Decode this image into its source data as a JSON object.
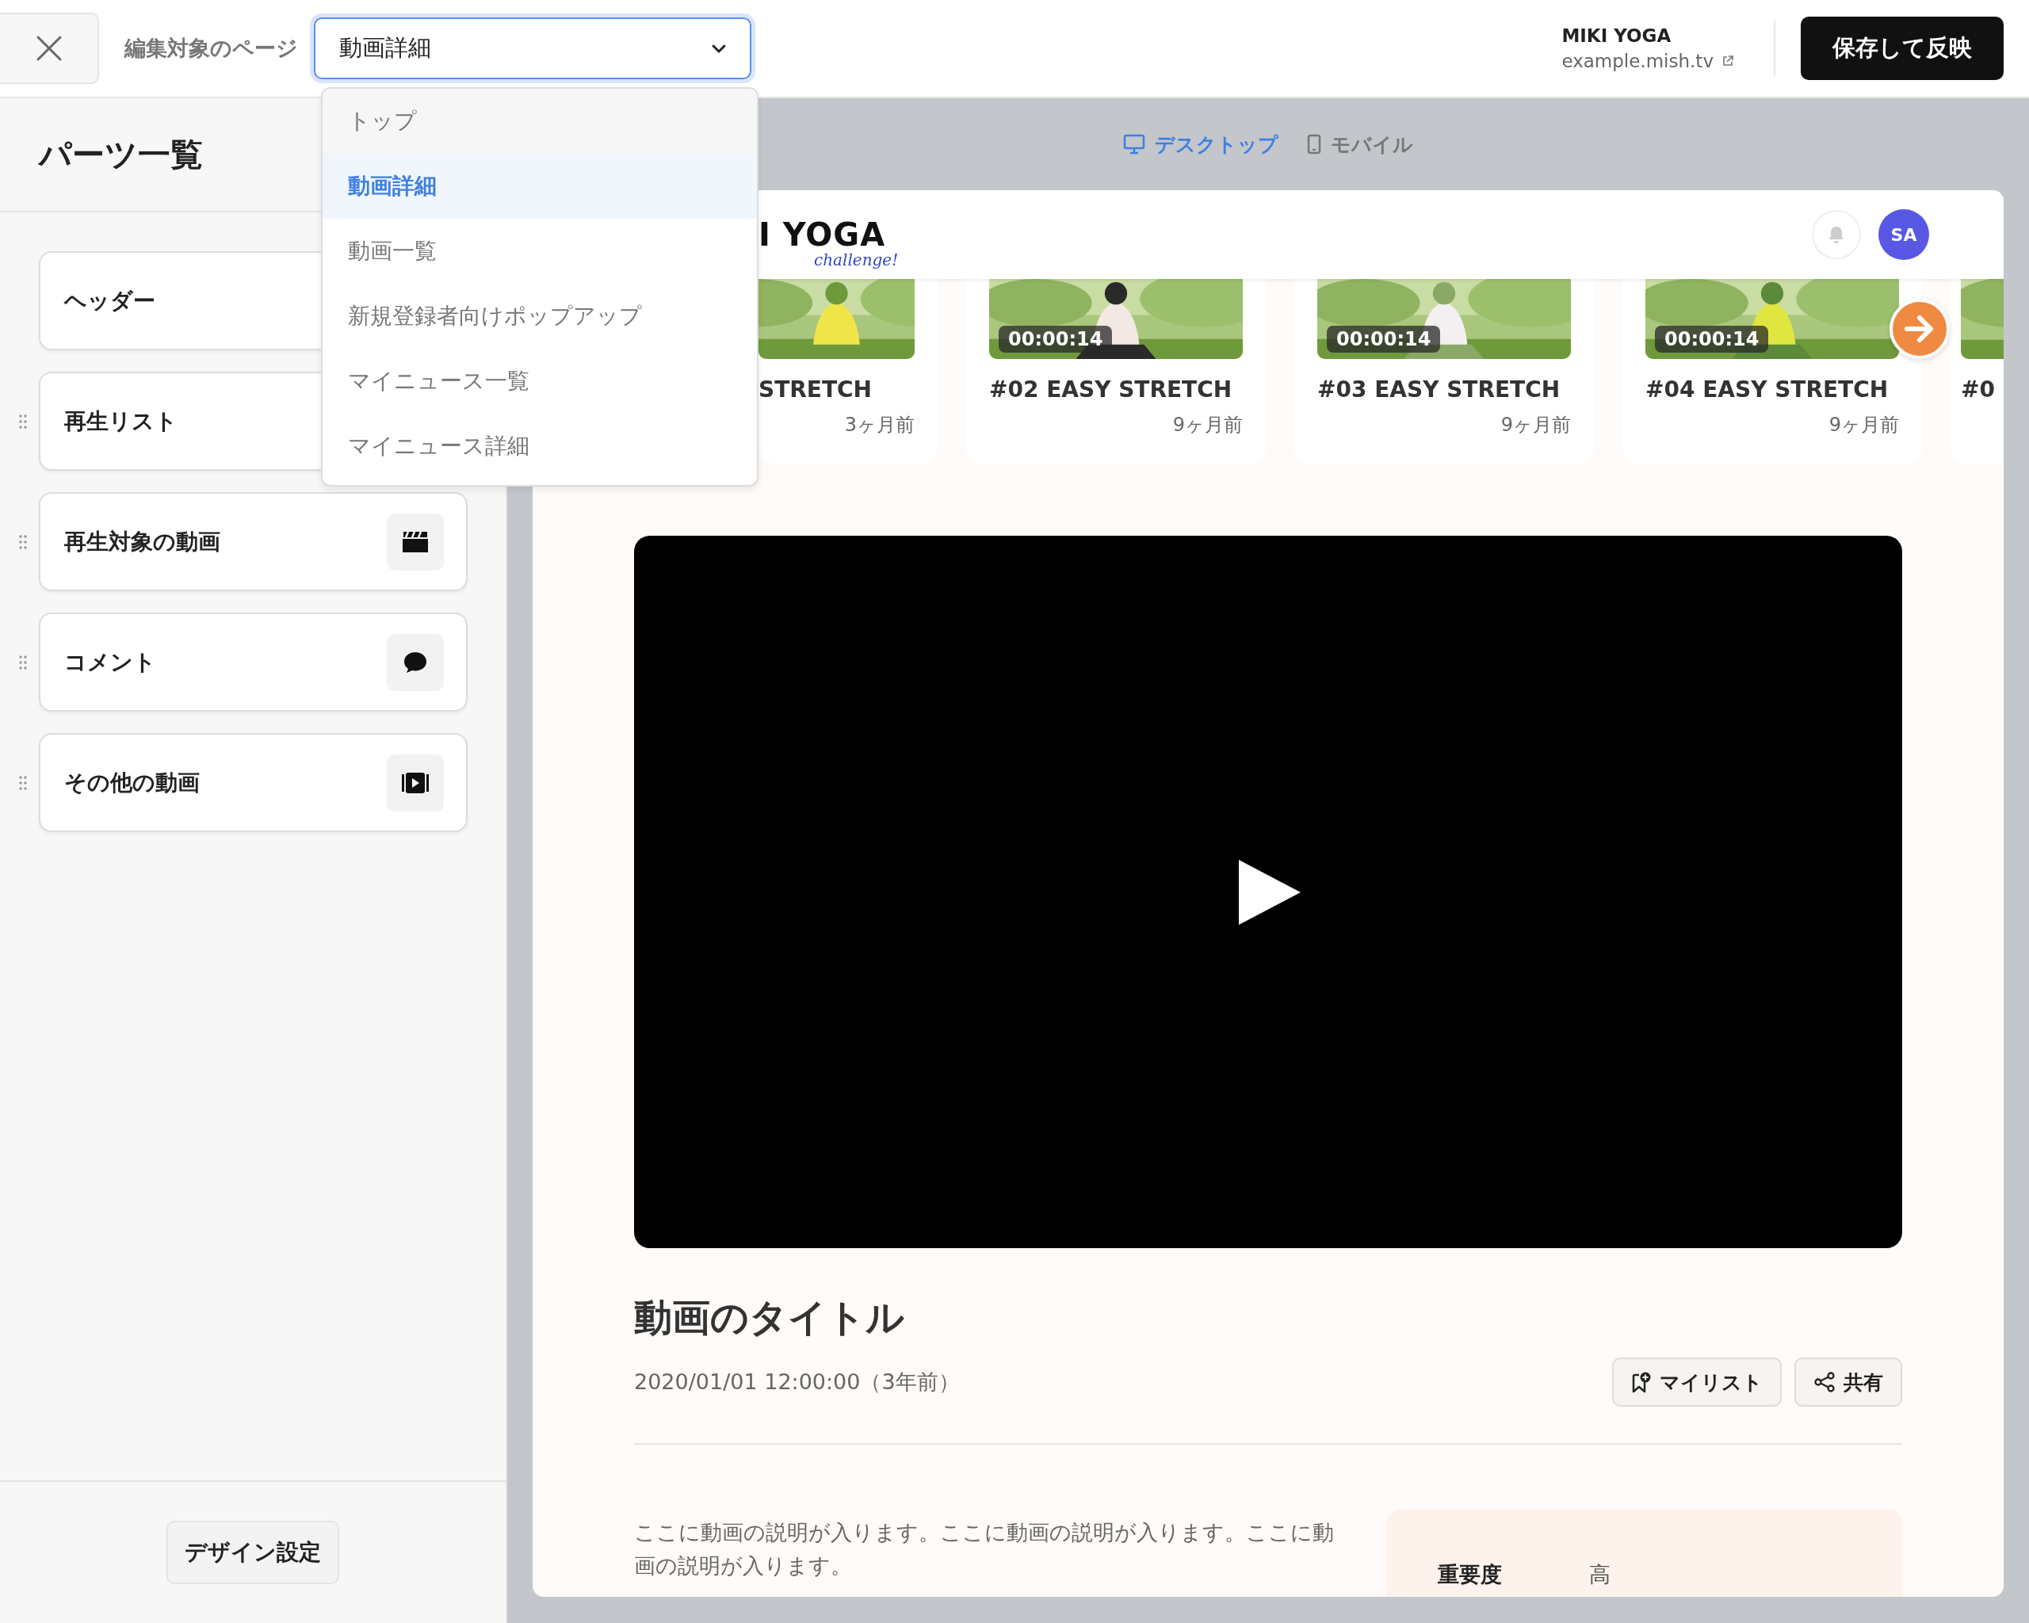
{
  "topbar": {
    "page_select": {
      "label": "編集対象のページ",
      "value": "動画詳細",
      "options": [
        {
          "label": "トップ",
          "selected": false
        },
        {
          "label": "動画詳細",
          "selected": true
        },
        {
          "label": "動画一覧",
          "selected": false
        },
        {
          "label": "新規登録者向けポップアップ",
          "selected": false
        },
        {
          "label": "マイニュース一覧",
          "selected": false
        },
        {
          "label": "マイニュース詳細",
          "selected": false
        }
      ]
    },
    "site": {
      "name": "MIKI YOGA",
      "url": "example.mish.tv"
    },
    "save_button": "保存して反映"
  },
  "sidebar": {
    "title": "パーツ一覧",
    "parts": [
      {
        "label": "ヘッダー",
        "draggable": false
      },
      {
        "label": "再生リスト",
        "draggable": true
      },
      {
        "label": "再生対象の動画",
        "draggable": true,
        "kind": "clapper"
      },
      {
        "label": "コメント",
        "draggable": true,
        "kind": "comment"
      },
      {
        "label": "その他の動画",
        "draggable": true,
        "kind": "video"
      }
    ],
    "design_button": "デザイン設定"
  },
  "preview": {
    "device_tabs": [
      {
        "label": "デスクトップ",
        "kind": "desktop",
        "selected": true
      },
      {
        "label": "モバイル",
        "kind": "mobile",
        "selected": false
      }
    ],
    "header": {
      "logo": "I YOGA",
      "tagline": "challenge!",
      "avatar": "SA"
    },
    "videos": [
      {
        "title": "STRETCH",
        "age": "3ヶ月前"
      },
      {
        "duration": "00:00:14",
        "title": "#02 EASY STRETCH",
        "age": "9ヶ月前"
      },
      {
        "duration": "00:00:14",
        "title": "#03 EASY STRETCH",
        "age": "9ヶ月前"
      },
      {
        "duration": "00:00:14",
        "title": "#04 EASY STRETCH",
        "age": "9ヶ月前"
      },
      {
        "title": "#0"
      }
    ],
    "video": {
      "title": "動画のタイトル",
      "date": "2020/01/01 12:00:00（3年前）",
      "actions": [
        {
          "label": "マイリスト",
          "kind": "mylist"
        },
        {
          "label": "共有",
          "kind": "share"
        }
      ],
      "description": "ここに動画の説明が入ります。ここに動画の説明が入ります。ここに動画の説明が入ります。",
      "info": [
        {
          "label": "重要度",
          "value": "高"
        }
      ]
    }
  }
}
